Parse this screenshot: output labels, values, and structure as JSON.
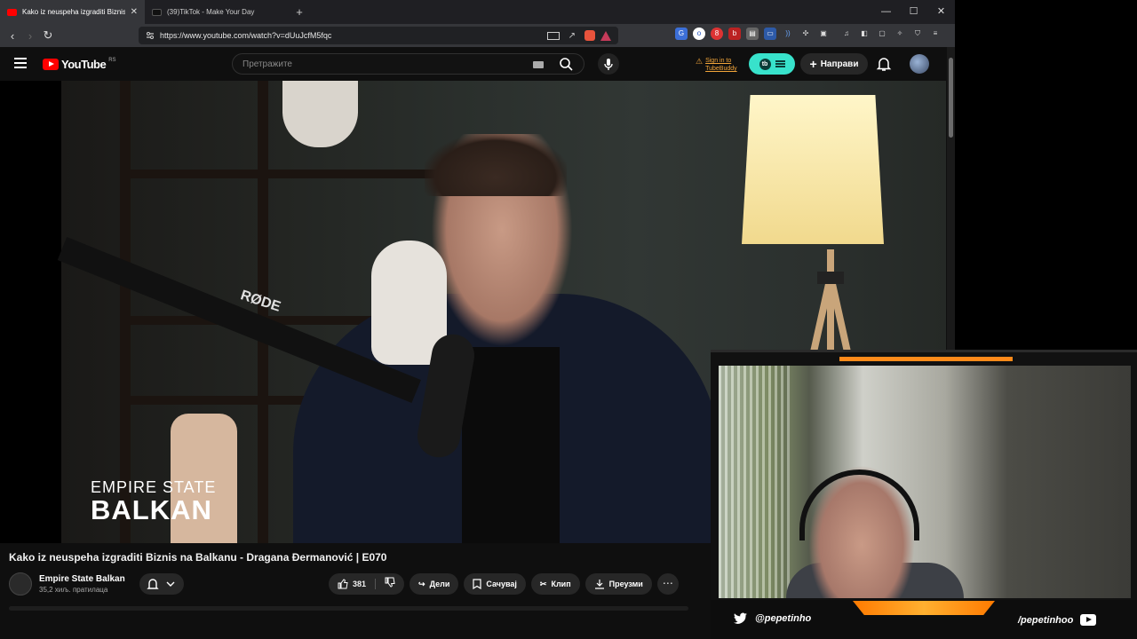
{
  "browser": {
    "tabs": [
      {
        "title": "Kako iz neuspeha izgraditi Biznis",
        "active": true,
        "favicon": "youtube-icon"
      },
      {
        "title": "(39)TikTok - Make Your Day",
        "active": false,
        "favicon": "tiktok-icon"
      }
    ],
    "new_tab": "+",
    "window_controls": {
      "minimize": "—",
      "maximize": "☐",
      "close": "✕"
    },
    "url": "https://www.youtube.com/watch?v=dUuJcfM5fqc"
  },
  "youtube": {
    "logo_text": "YouTube",
    "logo_country": "RS",
    "search_placeholder": "Претражите",
    "tubebuddy_signin": [
      "Sign in to",
      "TubeBuddy"
    ],
    "create_label": "Направи",
    "colors": {
      "brand_red": "#ff0000",
      "tubebuddy": "#38e2cb"
    }
  },
  "video": {
    "watermark_line1": "EMPIRE STATE",
    "watermark_line2": "BALKAN",
    "mic_brand": "RØDE",
    "title": "Kako iz neuspeha izgraditi Biznis na Balkanu - Dragana Đermanović | E070",
    "channel_name": "Empire State Balkan",
    "subscribers": "35,2 хиљ. пратилаца",
    "likes": "381",
    "share_label": "Дели",
    "save_label": "Сачувај",
    "clip_label": "Клип",
    "download_label": "Преузми",
    "more_label": "⋯"
  },
  "webcam_overlay": {
    "twitter_handle": "@pepetinho",
    "youtube_handle": "/pepetinhoo",
    "accent": "#ff8a1a"
  }
}
